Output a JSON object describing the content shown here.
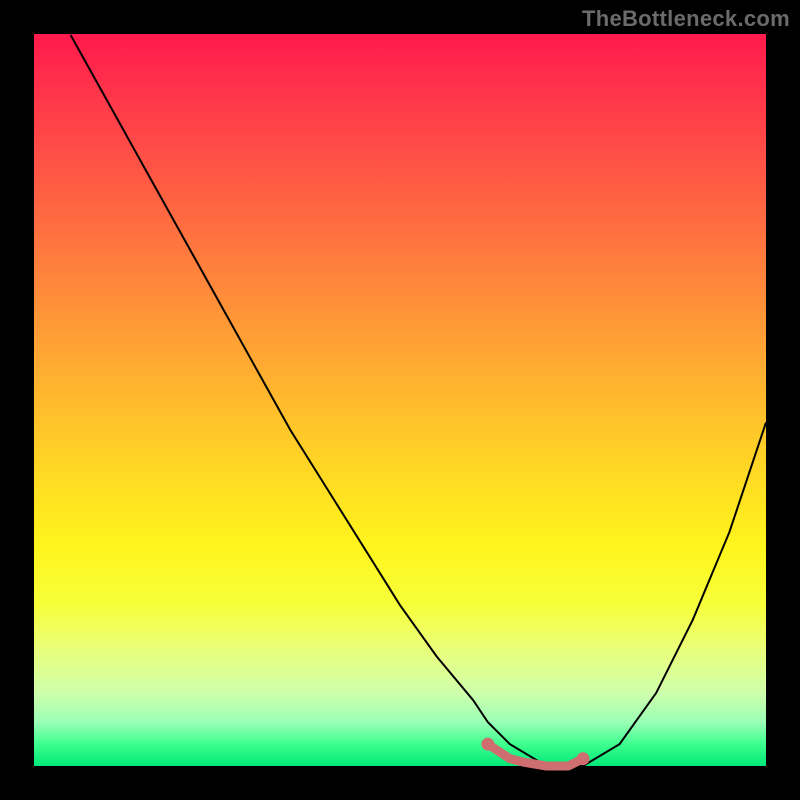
{
  "watermark": "TheBottleneck.com",
  "chart_data": {
    "type": "line",
    "title": "",
    "xlabel": "",
    "ylabel": "",
    "xlim": [
      0,
      100
    ],
    "ylim": [
      0,
      100
    ],
    "series": [
      {
        "name": "bottleneck-curve",
        "x": [
          5,
          10,
          15,
          20,
          25,
          30,
          35,
          40,
          45,
          50,
          55,
          60,
          62,
          65,
          70,
          73,
          75,
          80,
          85,
          90,
          95,
          100
        ],
        "values": [
          100,
          91,
          82,
          73,
          64,
          55,
          46,
          38,
          30,
          22,
          15,
          9,
          6,
          3,
          0,
          0,
          0,
          3,
          10,
          20,
          32,
          47
        ]
      }
    ],
    "highlight_band": {
      "name": "minimum-plateau",
      "color": "#cf6e70",
      "endpoint_radius": 6.5,
      "stroke_width": 9,
      "points_x": [
        62,
        65,
        67,
        70,
        73,
        75
      ],
      "points_y": [
        3,
        1,
        0.5,
        0,
        0,
        1
      ]
    },
    "curve_style": {
      "color": "#000000",
      "width": 2
    }
  }
}
